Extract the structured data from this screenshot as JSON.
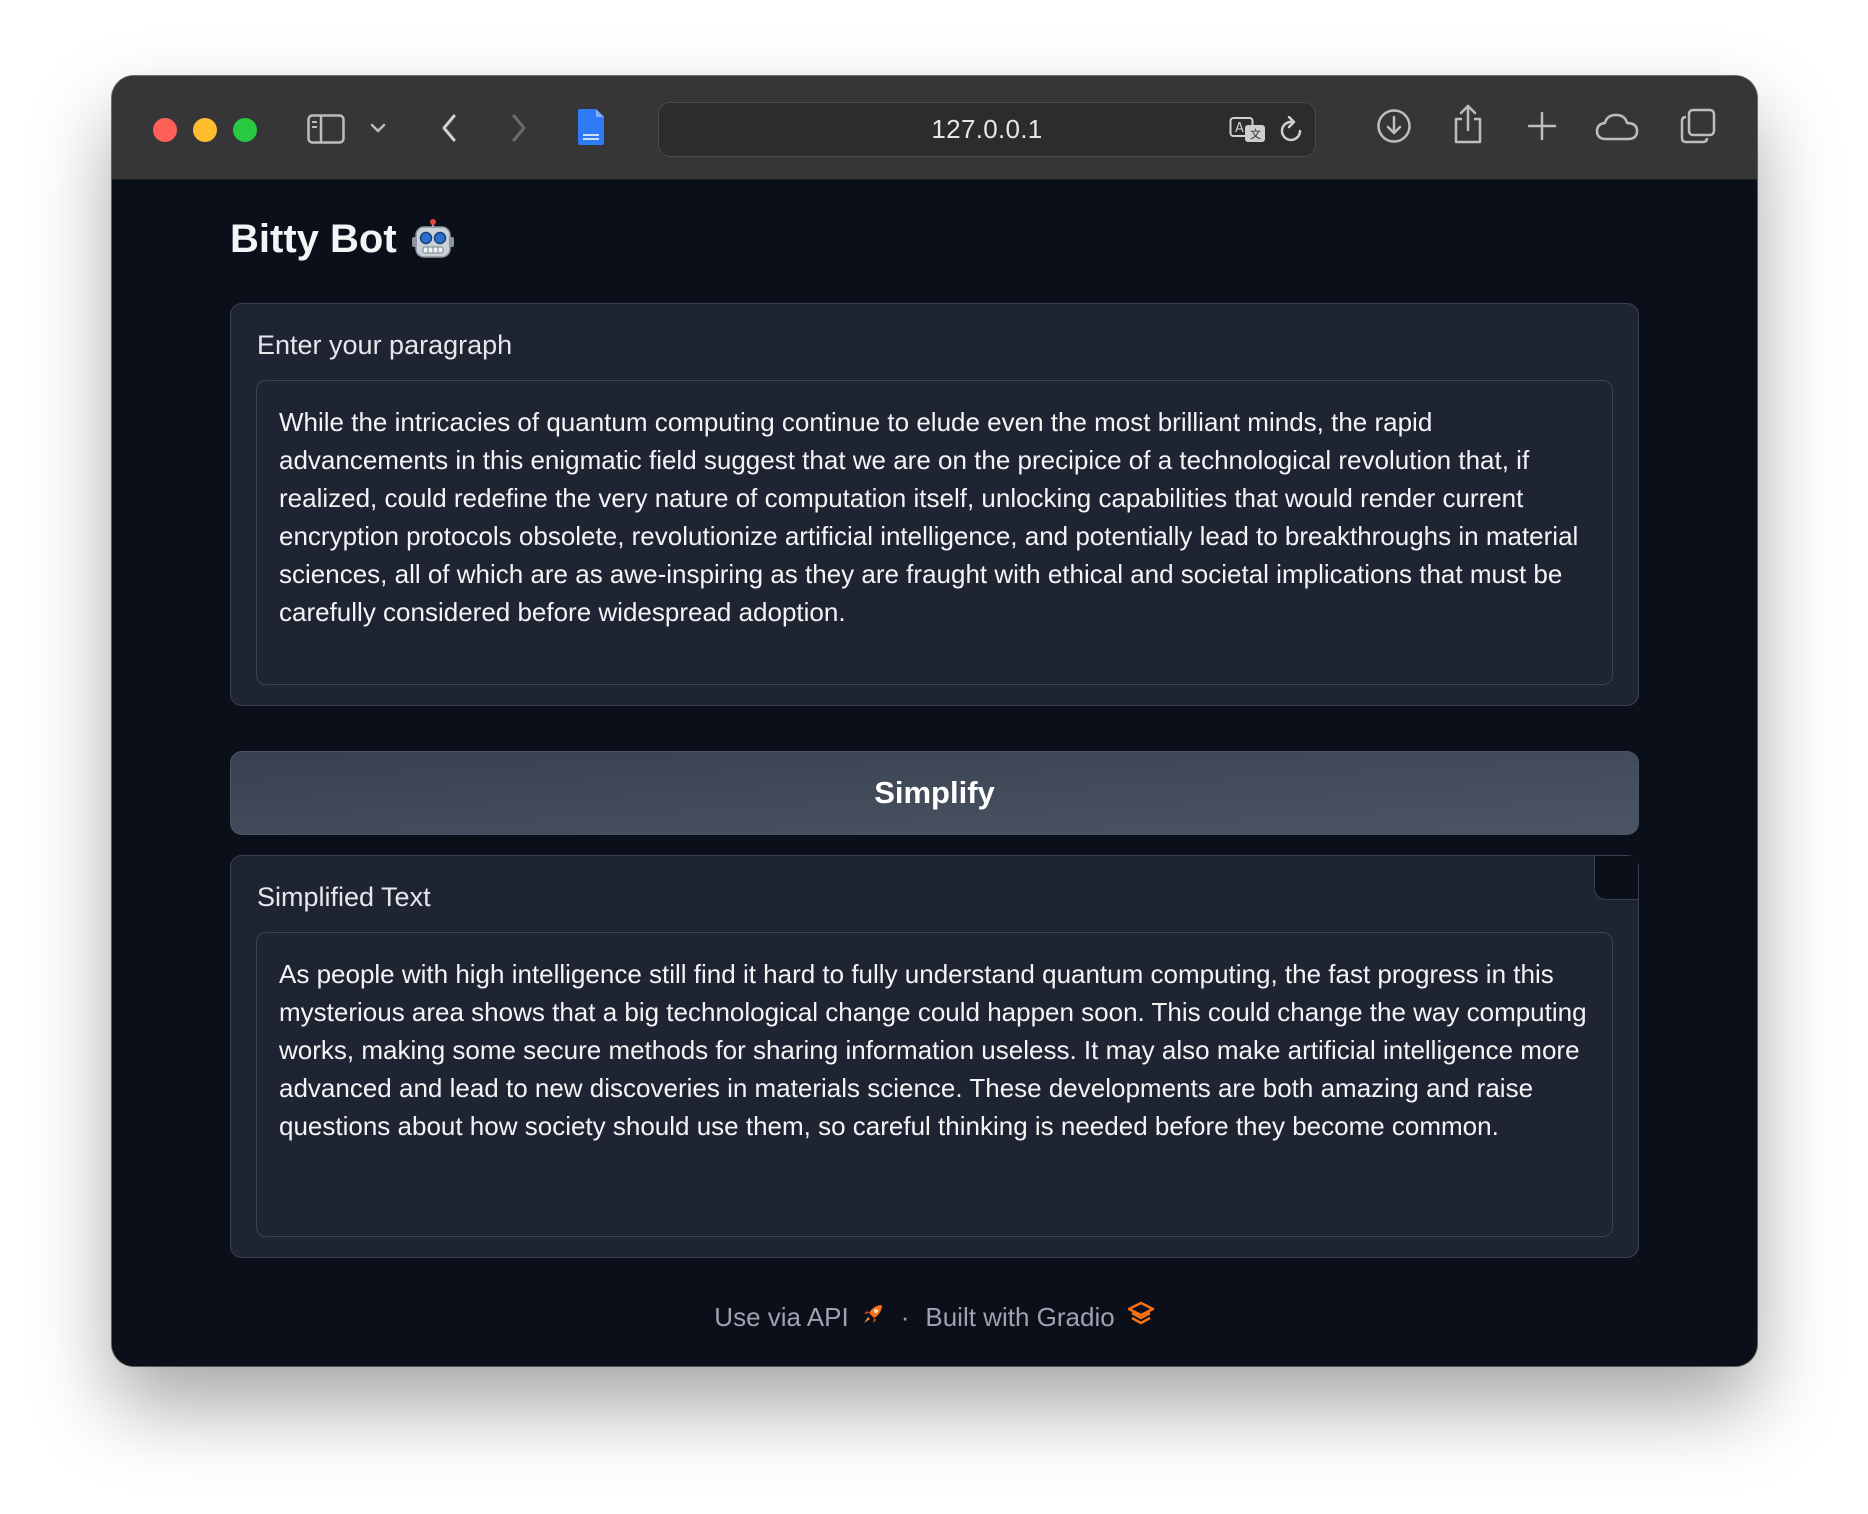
{
  "browser": {
    "url": "127.0.0.1",
    "icons": [
      "sidebar-icon",
      "chevron-down-icon",
      "back-icon",
      "forward-icon",
      "page-icon",
      "translate-icon",
      "reload-icon",
      "download-icon",
      "share-icon",
      "new-tab-icon",
      "icloud-icon",
      "tabs-overview-icon"
    ]
  },
  "app": {
    "title": "Bitty Bot",
    "title_emoji_icon": "robot-icon"
  },
  "input": {
    "label": "Enter your paragraph",
    "value": "While the intricacies of quantum computing continue to elude even the most brilliant minds, the rapid advancements in this enigmatic field suggest that we are on the precipice of a technological revolution that, if realized, could redefine the very nature of computation itself, unlocking capabilities that would render current encryption protocols obsolete, revolutionize artificial intelligence, and potentially lead to breakthroughs in material sciences, all of which are as awe-inspiring as they are fraught with ethical and societal implications that must be carefully considered before widespread adoption."
  },
  "button": {
    "label": "Simplify"
  },
  "output": {
    "label": "Simplified Text",
    "value": "As people with high intelligence still find it hard to fully understand quantum computing, the fast progress in this mysterious area shows that a big technological change could happen soon. This could change the way computing works, making some secure methods for sharing information useless. It may also make artificial intelligence more advanced and lead to new discoveries in materials science. These developments are both amazing and raise questions about how society should use them, so careful thinking is needed before they become common."
  },
  "footer": {
    "api_label": "Use via API",
    "separator": "·",
    "built_label": "Built with Gradio"
  },
  "colors": {
    "background": "#0b0f19",
    "panel": "#1f2433",
    "accent_orange": "#f97316"
  }
}
